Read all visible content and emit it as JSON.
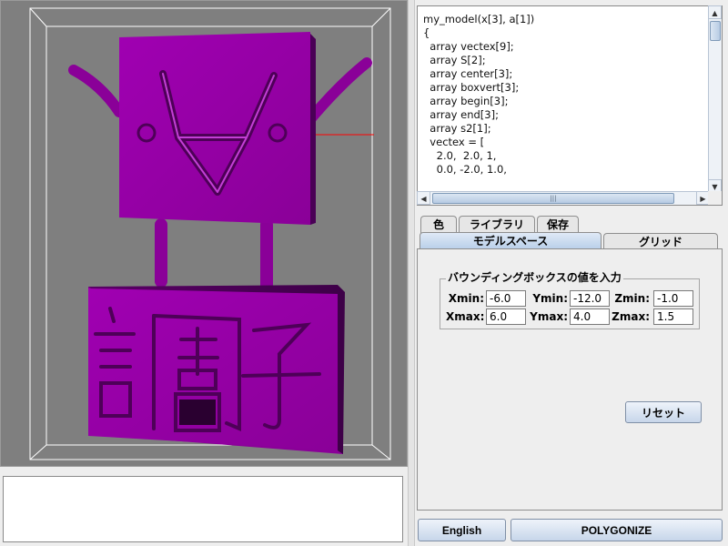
{
  "code_editor": {
    "lines": [
      "my_model(x[3], a[1])",
      "{",
      "  array vectex[9];",
      "  array S[2];",
      "  array center[3];",
      "  array boxvert[3];",
      "  array begin[3];",
      "  array end[3];",
      "  array s2[1];",
      "",
      "  vectex = [",
      "    2.0,  2.0, 1,",
      "    0.0, -2.0, 1.0,"
    ]
  },
  "tabs_top": [
    {
      "label": "色"
    },
    {
      "label": "ライブラリ"
    },
    {
      "label": "保存"
    }
  ],
  "tabs_bottom": [
    {
      "label": "モデルスペース",
      "active": true
    },
    {
      "label": "グリッド",
      "active": false
    }
  ],
  "bounding_box": {
    "title": "バウンディングボックスの値を入力",
    "xmin_label": "Xmin:",
    "xmin": "-6.0",
    "ymin_label": "Ymin:",
    "ymin": "-12.0",
    "zmin_label": "Zmin:",
    "zmin": "-1.0",
    "xmax_label": "Xmax:",
    "xmax": "6.0",
    "ymax_label": "Ymax:",
    "ymax": "4.0",
    "zmax_label": "Zmax:",
    "zmax": "1.5"
  },
  "buttons": {
    "reset": "リセット",
    "language": "English",
    "polygonize": "POLYGONIZE"
  },
  "viewport": {
    "model_color": "#9400a4",
    "background_color": "#7f7f7f",
    "box_line_color": "#ffffff",
    "axis_color": "#ff0000",
    "sign_kanji": [
      "調",
      "子"
    ]
  },
  "console": {
    "text": ""
  }
}
